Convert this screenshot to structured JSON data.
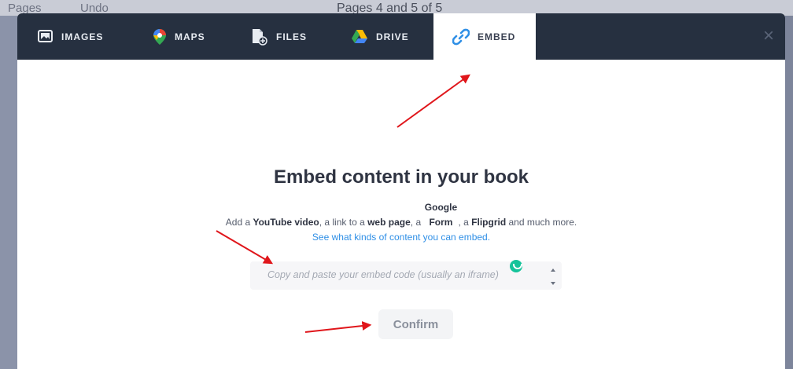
{
  "background": {
    "left_text": "Pages",
    "mid_text": "Undo",
    "title": "Pages 4 and 5 of 5"
  },
  "tabs": [
    {
      "label": "IMAGES",
      "icon": "images-icon"
    },
    {
      "label": "MAPS",
      "icon": "map-pin-icon"
    },
    {
      "label": "FILES",
      "icon": "file-add-icon"
    },
    {
      "label": "DRIVE",
      "icon": "drive-icon"
    },
    {
      "label": "EMBED",
      "icon": "link-icon",
      "active": true
    }
  ],
  "close_label": "×",
  "embed": {
    "heading": "Embed content in your book",
    "desc": {
      "p1": "Add a ",
      "b1": "YouTube video",
      "p2": ", a link to a ",
      "b2": "web page",
      "p3": ", a ",
      "b3": "Google Form",
      "p4": ", a ",
      "b4": "Flipgrid",
      "p5": " and much more.",
      "link": "See what kinds of content you can embed."
    },
    "input_placeholder": "Copy and paste your embed code (usually an iframe)",
    "confirm_label": "Confirm"
  },
  "colors": {
    "tabbar": "#263040",
    "accent_link": "#2f8fe6",
    "annotation_arrow": "#e0161b"
  }
}
